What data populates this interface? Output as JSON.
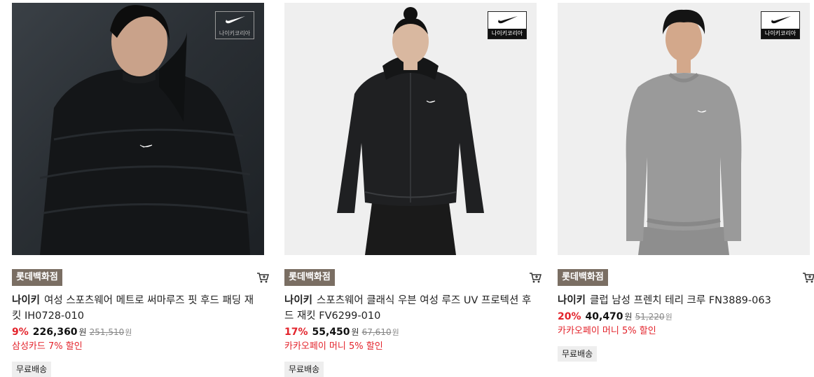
{
  "products": [
    {
      "store": "롯데백화점",
      "brand": "나이키",
      "title": "여성 스포츠웨어 메트로 써마루즈 핏 후드 패딩 재킷 IH0728-010",
      "discount": "9%",
      "price": "226,360",
      "won": "원",
      "original_price": "251,510",
      "promo": "삼성카드 7% 할인",
      "shipping": "무료배송",
      "logo_text": "나이키코리아"
    },
    {
      "store": "롯데백화점",
      "brand": "나이키",
      "title": "스포츠웨어 클래식 우븐 여성 루즈 UV 프로텍션 후드 재킷 FV6299-010",
      "discount": "17%",
      "price": "55,450",
      "won": "원",
      "original_price": "67,610",
      "promo": "카카오페이 머니 5% 할인",
      "shipping": "무료배송",
      "logo_text": "나이키코리아"
    },
    {
      "store": "롯데백화점",
      "brand": "나이키",
      "title": "클럽 남성 프렌치 테리 크루 FN3889-063",
      "discount": "20%",
      "price": "40,470",
      "won": "원",
      "original_price": "51,220",
      "promo": "카카오페이 머니 5% 할인",
      "shipping": "무료배송",
      "logo_text": "나이키코리아"
    }
  ],
  "icons": {
    "cart": "cart-icon",
    "logo": "nike-swoosh-icon"
  },
  "colors": {
    "discount": "#e3232b",
    "store_badge": "#7a6e63"
  }
}
